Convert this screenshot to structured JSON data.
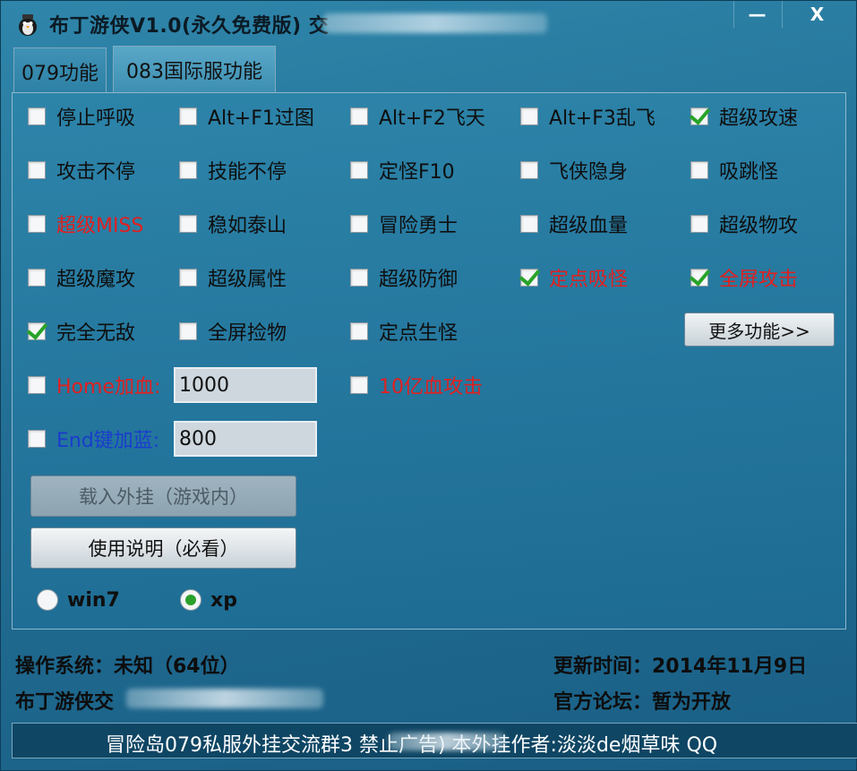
{
  "window": {
    "title": "布丁游侠V1.0(永久免费版)  交",
    "minimize": "—",
    "close": "X"
  },
  "tabs": [
    {
      "label": "079功能"
    },
    {
      "label": "083国际服功能"
    }
  ],
  "features": [
    {
      "label": "停止呼吸",
      "checked": false,
      "color": "normal"
    },
    {
      "label": "Alt+F1过图",
      "checked": false,
      "color": "normal"
    },
    {
      "label": "Alt+F2飞天",
      "checked": false,
      "color": "normal"
    },
    {
      "label": "Alt+F3乱飞",
      "checked": false,
      "color": "normal"
    },
    {
      "label": "超级攻速",
      "checked": true,
      "color": "normal"
    },
    {
      "label": "攻击不停",
      "checked": false,
      "color": "normal"
    },
    {
      "label": "技能不停",
      "checked": false,
      "color": "normal"
    },
    {
      "label": "定怪F10",
      "checked": false,
      "color": "normal"
    },
    {
      "label": "飞侠隐身",
      "checked": false,
      "color": "normal"
    },
    {
      "label": "吸跳怪",
      "checked": false,
      "color": "normal"
    },
    {
      "label": "超级MISS",
      "checked": false,
      "color": "red"
    },
    {
      "label": "稳如泰山",
      "checked": false,
      "color": "normal"
    },
    {
      "label": "冒险勇士",
      "checked": false,
      "color": "normal"
    },
    {
      "label": "超级血量",
      "checked": false,
      "color": "normal"
    },
    {
      "label": "超级物攻",
      "checked": false,
      "color": "normal"
    },
    {
      "label": "超级魔攻",
      "checked": false,
      "color": "normal"
    },
    {
      "label": "超级属性",
      "checked": false,
      "color": "normal"
    },
    {
      "label": "超级防御",
      "checked": false,
      "color": "normal"
    },
    {
      "label": "定点吸怪",
      "checked": true,
      "color": "red"
    },
    {
      "label": "全屏攻击",
      "checked": true,
      "color": "red"
    },
    {
      "label": "完全无敌",
      "checked": true,
      "color": "normal"
    },
    {
      "label": "全屏捡物",
      "checked": false,
      "color": "normal"
    },
    {
      "label": "定点生怪",
      "checked": false,
      "color": "normal"
    }
  ],
  "home_heal": {
    "label": "Home加血:",
    "checked": false,
    "value": "1000"
  },
  "end_mana": {
    "label": "End键加蓝:",
    "checked": false,
    "value": "800"
  },
  "billion_attack": {
    "label": "10亿血攻击",
    "checked": false
  },
  "buttons": {
    "more": "更多功能>>",
    "load": "载入外挂（游戏内）",
    "help": "使用说明（必看）"
  },
  "os_options": [
    {
      "label": "win7",
      "selected": false
    },
    {
      "label": "xp",
      "selected": true
    }
  ],
  "status": {
    "os": "操作系统：未知（64位）",
    "update": "更新时间：2014年11月9日",
    "group": "布丁游侠交",
    "forum": "官方论坛：暂为开放"
  },
  "marquee": "冒险岛079私服外挂交流群3          禁止广告) 本外挂作者:淡淡de烟草味 QQ",
  "colors": {
    "check": "#29a329",
    "red_text": "#e02020",
    "blue_text": "#1a3dcc"
  }
}
